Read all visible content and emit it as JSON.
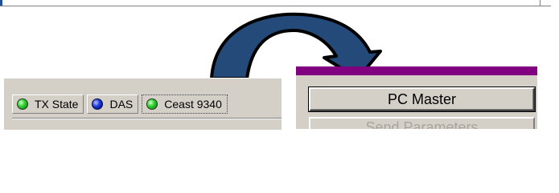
{
  "status_tabs": [
    {
      "label": "TX State",
      "led_color": "#34d334"
    },
    {
      "label": "DAS",
      "led_color": "#1836d8"
    },
    {
      "label": "Ceast 9340",
      "led_color": "#34d334"
    }
  ],
  "pc_panel": {
    "accent_color": "#800080",
    "pc_master_label": "PC Master",
    "next_button_label": "Send Parameters"
  },
  "icons": {
    "arrow": "curved-arrow-icon",
    "led": "status-led-icon"
  },
  "colors": {
    "arrow_fill": "#244a7a",
    "panel_bg": "#d4d0c8"
  }
}
